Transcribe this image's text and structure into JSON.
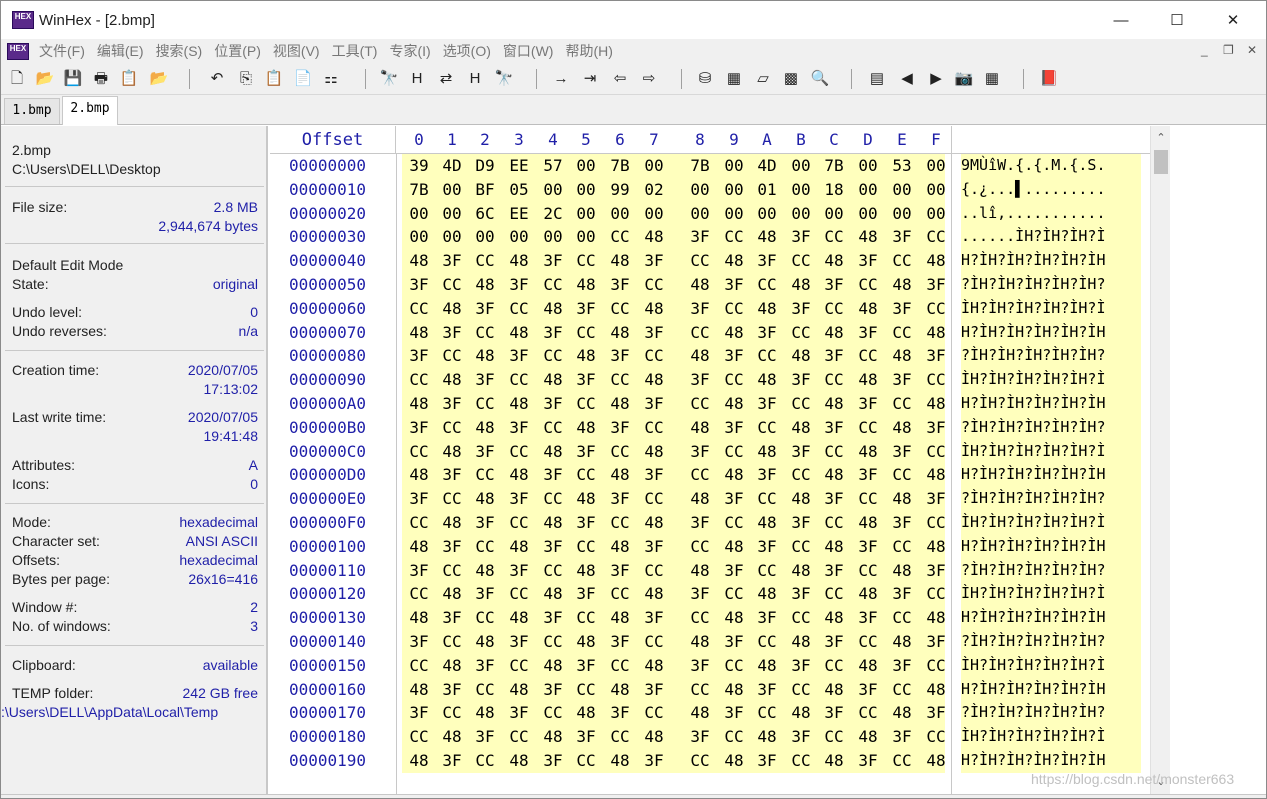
{
  "window": {
    "title": "WinHex - [2.bmp]",
    "logo_text": "HEX",
    "minimize_glyph": "—",
    "maximize_glyph": "☐",
    "close_glyph": "✕"
  },
  "menu": {
    "items": [
      "文件(F)",
      "编辑(E)",
      "搜索(S)",
      "位置(P)",
      "视图(V)",
      "工具(T)",
      "专家(I)",
      "选项(O)",
      "窗口(W)",
      "帮助(H)"
    ],
    "mdi_min": "_",
    "mdi_restore": "❐",
    "mdi_close": "✕"
  },
  "toolbar": {
    "icons": [
      {
        "name": "new-file-icon",
        "glyph": "🗋"
      },
      {
        "name": "open-folder-icon",
        "glyph": "📂"
      },
      {
        "name": "save-icon",
        "glyph": "💾"
      },
      {
        "name": "print-icon",
        "glyph": "🖶"
      },
      {
        "name": "properties-icon",
        "glyph": "📋"
      },
      {
        "name": "open-multiple-icon",
        "glyph": "📂"
      },
      {
        "name": "undo-icon",
        "glyph": "↶"
      },
      {
        "name": "copy-icon",
        "glyph": "⎘"
      },
      {
        "name": "paste-icon",
        "glyph": "📋"
      },
      {
        "name": "paste-special-icon",
        "glyph": "📄"
      },
      {
        "name": "binary-icon",
        "glyph": "⚏"
      },
      {
        "name": "find-text-icon",
        "glyph": "🔭"
      },
      {
        "name": "find-hex-icon",
        "glyph": "H"
      },
      {
        "name": "replace-text-icon",
        "glyph": "⇄"
      },
      {
        "name": "replace-hex-icon",
        "glyph": "H"
      },
      {
        "name": "find-next-icon",
        "glyph": "🔭"
      },
      {
        "name": "goto-offset-icon",
        "glyph": "→"
      },
      {
        "name": "goto-sector-icon",
        "glyph": "⇥"
      },
      {
        "name": "back-icon",
        "glyph": "⇦"
      },
      {
        "name": "forward-icon",
        "glyph": "⇨"
      },
      {
        "name": "open-disk-icon",
        "glyph": "⛁"
      },
      {
        "name": "ram-editor-icon",
        "glyph": "▦"
      },
      {
        "name": "disk-tools-icon",
        "glyph": "▱"
      },
      {
        "name": "calculator-icon",
        "glyph": "▩"
      },
      {
        "name": "analyze-icon",
        "glyph": "🔍"
      },
      {
        "name": "interpreter-icon",
        "glyph": "▤"
      },
      {
        "name": "prev-block-icon",
        "glyph": "◀"
      },
      {
        "name": "next-block-icon",
        "glyph": "▶"
      },
      {
        "name": "snapshot-icon",
        "glyph": "📷"
      },
      {
        "name": "table-icon",
        "glyph": "▦"
      },
      {
        "name": "help-book-icon",
        "glyph": "📕"
      }
    ]
  },
  "tabs": [
    {
      "label": "1.bmp",
      "active": false
    },
    {
      "label": "2.bmp",
      "active": true
    }
  ],
  "info": {
    "filename": "2.bmp",
    "path": "C:\\Users\\DELL\\Desktop",
    "file_size_label": "File size:",
    "file_size_mb": "2.8 MB",
    "file_size_bytes": "2,944,674 bytes",
    "edit_mode_heading": "Default Edit Mode",
    "state_label": "State:",
    "state_value": "original",
    "undo_level_label": "Undo level:",
    "undo_level_value": "0",
    "undo_reverses_label": "Undo reverses:",
    "undo_reverses_value": "n/a",
    "creation_label": "Creation time:",
    "creation_date": "2020/07/05",
    "creation_time": "17:13:02",
    "lastwrite_label": "Last write time:",
    "lastwrite_date": "2020/07/05",
    "lastwrite_time": "19:41:48",
    "attributes_label": "Attributes:",
    "attributes_value": "A",
    "icons_label": "Icons:",
    "icons_value": "0",
    "mode_label": "Mode:",
    "mode_value": "hexadecimal",
    "charset_label": "Character set:",
    "charset_value": "ANSI ASCII",
    "offsets_label": "Offsets:",
    "offsets_value": "hexadecimal",
    "bpp_label": "Bytes per page:",
    "bpp_value": "26x16=416",
    "window_num_label": "Window #:",
    "window_num_value": "2",
    "num_windows_label": "No. of windows:",
    "num_windows_value": "3",
    "clipboard_label": "Clipboard:",
    "clipboard_value": "available",
    "temp_label": "TEMP folder:",
    "temp_value": "242 GB free",
    "temp_path": ":\\Users\\DELL\\AppData\\Local\\Temp"
  },
  "hex": {
    "offset_header": "Offset",
    "column_headers": [
      "0",
      "1",
      "2",
      "3",
      "4",
      "5",
      "6",
      "7",
      "8",
      "9",
      "A",
      "B",
      "C",
      "D",
      "E",
      "F"
    ],
    "rows": [
      {
        "offset": "00000000",
        "bytes": [
          "39",
          "4D",
          "D9",
          "EE",
          "57",
          "00",
          "7B",
          "00",
          "7B",
          "00",
          "4D",
          "00",
          "7B",
          "00",
          "53",
          "00"
        ],
        "text": "9MÙîW.{.{.M.{.S."
      },
      {
        "offset": "00000010",
        "bytes": [
          "7B",
          "00",
          "BF",
          "05",
          "00",
          "00",
          "99",
          "02",
          "00",
          "00",
          "01",
          "00",
          "18",
          "00",
          "00",
          "00"
        ],
        "text": "{.¿...▌........."
      },
      {
        "offset": "00000020",
        "bytes": [
          "00",
          "00",
          "6C",
          "EE",
          "2C",
          "00",
          "00",
          "00",
          "00",
          "00",
          "00",
          "00",
          "00",
          "00",
          "00",
          "00"
        ],
        "text": "..lî,..........."
      },
      {
        "offset": "00000030",
        "bytes": [
          "00",
          "00",
          "00",
          "00",
          "00",
          "00",
          "CC",
          "48",
          "3F",
          "CC",
          "48",
          "3F",
          "CC",
          "48",
          "3F",
          "CC"
        ],
        "text": "......ÌH?ÌH?ÌH?Ì"
      },
      {
        "offset": "00000040",
        "bytes": [
          "48",
          "3F",
          "CC",
          "48",
          "3F",
          "CC",
          "48",
          "3F",
          "CC",
          "48",
          "3F",
          "CC",
          "48",
          "3F",
          "CC",
          "48"
        ],
        "text": "H?ÌH?ÌH?ÌH?ÌH?ÌH"
      },
      {
        "offset": "00000050",
        "bytes": [
          "3F",
          "CC",
          "48",
          "3F",
          "CC",
          "48",
          "3F",
          "CC",
          "48",
          "3F",
          "CC",
          "48",
          "3F",
          "CC",
          "48",
          "3F"
        ],
        "text": "?ÌH?ÌH?ÌH?ÌH?ÌH?"
      },
      {
        "offset": "00000060",
        "bytes": [
          "CC",
          "48",
          "3F",
          "CC",
          "48",
          "3F",
          "CC",
          "48",
          "3F",
          "CC",
          "48",
          "3F",
          "CC",
          "48",
          "3F",
          "CC"
        ],
        "text": "ÌH?ÌH?ÌH?ÌH?ÌH?Ì"
      },
      {
        "offset": "00000070",
        "bytes": [
          "48",
          "3F",
          "CC",
          "48",
          "3F",
          "CC",
          "48",
          "3F",
          "CC",
          "48",
          "3F",
          "CC",
          "48",
          "3F",
          "CC",
          "48"
        ],
        "text": "H?ÌH?ÌH?ÌH?ÌH?ÌH"
      },
      {
        "offset": "00000080",
        "bytes": [
          "3F",
          "CC",
          "48",
          "3F",
          "CC",
          "48",
          "3F",
          "CC",
          "48",
          "3F",
          "CC",
          "48",
          "3F",
          "CC",
          "48",
          "3F"
        ],
        "text": "?ÌH?ÌH?ÌH?ÌH?ÌH?"
      },
      {
        "offset": "00000090",
        "bytes": [
          "CC",
          "48",
          "3F",
          "CC",
          "48",
          "3F",
          "CC",
          "48",
          "3F",
          "CC",
          "48",
          "3F",
          "CC",
          "48",
          "3F",
          "CC"
        ],
        "text": "ÌH?ÌH?ÌH?ÌH?ÌH?Ì"
      },
      {
        "offset": "000000A0",
        "bytes": [
          "48",
          "3F",
          "CC",
          "48",
          "3F",
          "CC",
          "48",
          "3F",
          "CC",
          "48",
          "3F",
          "CC",
          "48",
          "3F",
          "CC",
          "48"
        ],
        "text": "H?ÌH?ÌH?ÌH?ÌH?ÌH"
      },
      {
        "offset": "000000B0",
        "bytes": [
          "3F",
          "CC",
          "48",
          "3F",
          "CC",
          "48",
          "3F",
          "CC",
          "48",
          "3F",
          "CC",
          "48",
          "3F",
          "CC",
          "48",
          "3F"
        ],
        "text": "?ÌH?ÌH?ÌH?ÌH?ÌH?"
      },
      {
        "offset": "000000C0",
        "bytes": [
          "CC",
          "48",
          "3F",
          "CC",
          "48",
          "3F",
          "CC",
          "48",
          "3F",
          "CC",
          "48",
          "3F",
          "CC",
          "48",
          "3F",
          "CC"
        ],
        "text": "ÌH?ÌH?ÌH?ÌH?ÌH?Ì"
      },
      {
        "offset": "000000D0",
        "bytes": [
          "48",
          "3F",
          "CC",
          "48",
          "3F",
          "CC",
          "48",
          "3F",
          "CC",
          "48",
          "3F",
          "CC",
          "48",
          "3F",
          "CC",
          "48"
        ],
        "text": "H?ÌH?ÌH?ÌH?ÌH?ÌH"
      },
      {
        "offset": "000000E0",
        "bytes": [
          "3F",
          "CC",
          "48",
          "3F",
          "CC",
          "48",
          "3F",
          "CC",
          "48",
          "3F",
          "CC",
          "48",
          "3F",
          "CC",
          "48",
          "3F"
        ],
        "text": "?ÌH?ÌH?ÌH?ÌH?ÌH?"
      },
      {
        "offset": "000000F0",
        "bytes": [
          "CC",
          "48",
          "3F",
          "CC",
          "48",
          "3F",
          "CC",
          "48",
          "3F",
          "CC",
          "48",
          "3F",
          "CC",
          "48",
          "3F",
          "CC"
        ],
        "text": "ÌH?ÌH?ÌH?ÌH?ÌH?Ì"
      },
      {
        "offset": "00000100",
        "bytes": [
          "48",
          "3F",
          "CC",
          "48",
          "3F",
          "CC",
          "48",
          "3F",
          "CC",
          "48",
          "3F",
          "CC",
          "48",
          "3F",
          "CC",
          "48"
        ],
        "text": "H?ÌH?ÌH?ÌH?ÌH?ÌH"
      },
      {
        "offset": "00000110",
        "bytes": [
          "3F",
          "CC",
          "48",
          "3F",
          "CC",
          "48",
          "3F",
          "CC",
          "48",
          "3F",
          "CC",
          "48",
          "3F",
          "CC",
          "48",
          "3F"
        ],
        "text": "?ÌH?ÌH?ÌH?ÌH?ÌH?"
      },
      {
        "offset": "00000120",
        "bytes": [
          "CC",
          "48",
          "3F",
          "CC",
          "48",
          "3F",
          "CC",
          "48",
          "3F",
          "CC",
          "48",
          "3F",
          "CC",
          "48",
          "3F",
          "CC"
        ],
        "text": "ÌH?ÌH?ÌH?ÌH?ÌH?Ì"
      },
      {
        "offset": "00000130",
        "bytes": [
          "48",
          "3F",
          "CC",
          "48",
          "3F",
          "CC",
          "48",
          "3F",
          "CC",
          "48",
          "3F",
          "CC",
          "48",
          "3F",
          "CC",
          "48"
        ],
        "text": "H?ÌH?ÌH?ÌH?ÌH?ÌH"
      },
      {
        "offset": "00000140",
        "bytes": [
          "3F",
          "CC",
          "48",
          "3F",
          "CC",
          "48",
          "3F",
          "CC",
          "48",
          "3F",
          "CC",
          "48",
          "3F",
          "CC",
          "48",
          "3F"
        ],
        "text": "?ÌH?ÌH?ÌH?ÌH?ÌH?"
      },
      {
        "offset": "00000150",
        "bytes": [
          "CC",
          "48",
          "3F",
          "CC",
          "48",
          "3F",
          "CC",
          "48",
          "3F",
          "CC",
          "48",
          "3F",
          "CC",
          "48",
          "3F",
          "CC"
        ],
        "text": "ÌH?ÌH?ÌH?ÌH?ÌH?Ì"
      },
      {
        "offset": "00000160",
        "bytes": [
          "48",
          "3F",
          "CC",
          "48",
          "3F",
          "CC",
          "48",
          "3F",
          "CC",
          "48",
          "3F",
          "CC",
          "48",
          "3F",
          "CC",
          "48"
        ],
        "text": "H?ÌH?ÌH?ÌH?ÌH?ÌH"
      },
      {
        "offset": "00000170",
        "bytes": [
          "3F",
          "CC",
          "48",
          "3F",
          "CC",
          "48",
          "3F",
          "CC",
          "48",
          "3F",
          "CC",
          "48",
          "3F",
          "CC",
          "48",
          "3F"
        ],
        "text": "?ÌH?ÌH?ÌH?ÌH?ÌH?"
      },
      {
        "offset": "00000180",
        "bytes": [
          "CC",
          "48",
          "3F",
          "CC",
          "48",
          "3F",
          "CC",
          "48",
          "3F",
          "CC",
          "48",
          "3F",
          "CC",
          "48",
          "3F",
          "CC"
        ],
        "text": "ÌH?ÌH?ÌH?ÌH?ÌH?Ì"
      },
      {
        "offset": "00000190",
        "bytes": [
          "48",
          "3F",
          "CC",
          "48",
          "3F",
          "CC",
          "48",
          "3F",
          "CC",
          "48",
          "3F",
          "CC",
          "48",
          "3F",
          "CC",
          "48"
        ],
        "text": "H?ÌH?ÌH?ÌH?ÌH?ÌH"
      }
    ]
  },
  "scrollbar": {
    "up_glyph": "⌃",
    "down_glyph": "⌄"
  },
  "watermark": "https://blog.csdn.net/monster663",
  "colors": {
    "accent_blue": "#1f1fa8",
    "hex_background": "#ffffbd"
  }
}
